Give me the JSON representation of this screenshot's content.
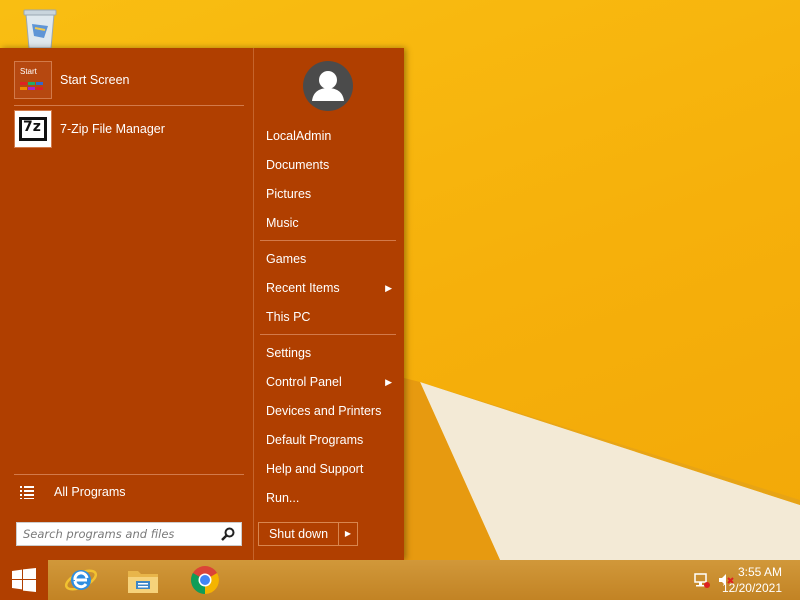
{
  "start_menu": {
    "pinned": [
      {
        "label": "Start Screen",
        "tile_text": "Start"
      },
      {
        "label": "7-Zip File Manager",
        "tile_text": "7z"
      }
    ],
    "all_programs_label": "All Programs",
    "search": {
      "placeholder": "Search programs and files"
    },
    "right_items": {
      "user": "LocalAdmin",
      "documents": "Documents",
      "pictures": "Pictures",
      "music": "Music",
      "games": "Games",
      "recent_items": "Recent Items",
      "this_pc": "This PC",
      "settings": "Settings",
      "control_panel": "Control Panel",
      "devices_printers": "Devices and Printers",
      "default_programs": "Default Programs",
      "help_support": "Help and Support",
      "run": "Run..."
    },
    "shutdown_label": "Shut down"
  },
  "taskbar": {
    "apps": [
      "internet-explorer-icon",
      "file-explorer-icon",
      "chrome-icon"
    ],
    "clock": {
      "time": "3:55 AM",
      "date": "12/20/2021"
    }
  },
  "colors": {
    "menu_bg": "#b03f00",
    "desktop_bg": "#f8b70e",
    "taskbar_bg": "#c88d2c"
  }
}
